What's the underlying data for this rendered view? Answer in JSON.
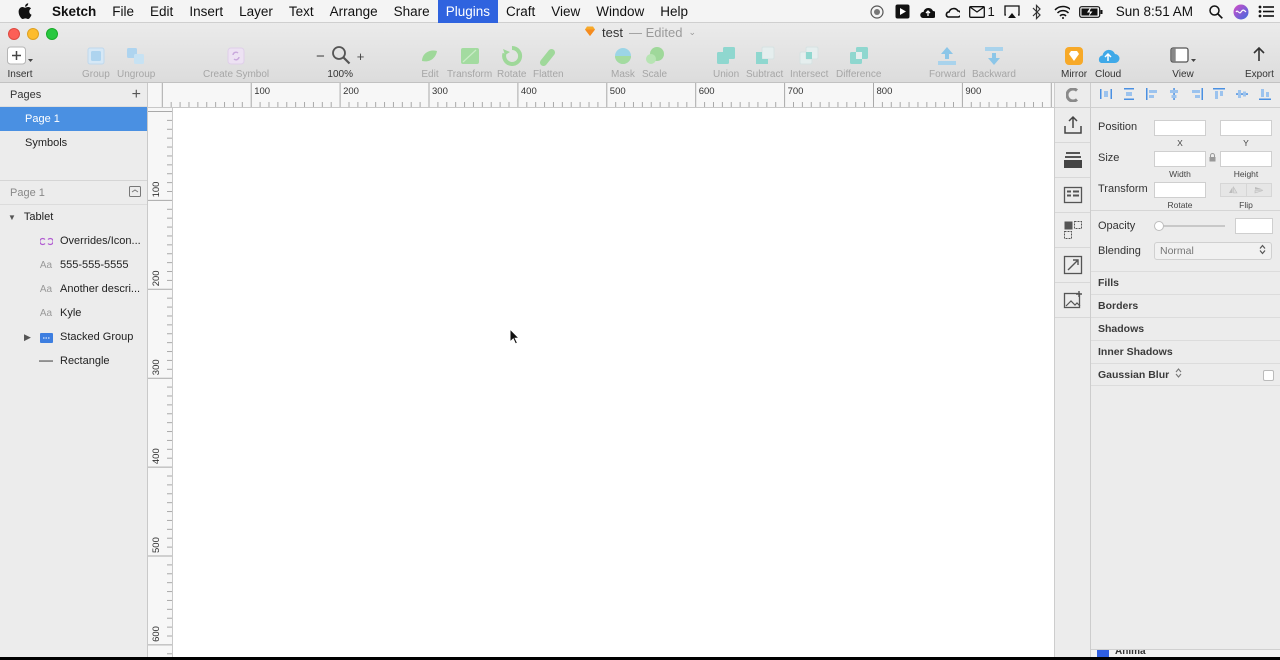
{
  "menubar": {
    "app_name": "Sketch",
    "items": [
      "File",
      "Edit",
      "Insert",
      "Layer",
      "Text",
      "Arrange",
      "Share",
      "Plugins",
      "Craft",
      "View",
      "Window",
      "Help"
    ],
    "active_item": "Plugins",
    "mail_count": "1",
    "clock": "Sun 8:51 AM"
  },
  "window": {
    "title": "test",
    "status": "— Edited"
  },
  "toolbar": {
    "insert": "Insert",
    "group": "Group",
    "ungroup": "Ungroup",
    "create_symbol": "Create Symbol",
    "zoom": "100%",
    "edit": "Edit",
    "transform": "Transform",
    "rotate": "Rotate",
    "flatten": "Flatten",
    "mask": "Mask",
    "scale": "Scale",
    "union": "Union",
    "subtract": "Subtract",
    "intersect": "Intersect",
    "difference": "Difference",
    "forward": "Forward",
    "backward": "Backward",
    "mirror": "Mirror",
    "cloud": "Cloud",
    "view": "View",
    "export": "Export"
  },
  "pages": {
    "header": "Pages",
    "items": [
      "Page 1",
      "Symbols"
    ],
    "selected": "Page 1"
  },
  "layers": {
    "header": "Page 1",
    "artboard": "Tablet",
    "items": [
      {
        "name": "Overrides/Icon...",
        "icon": "symbol-instance-icon"
      },
      {
        "name": "555-555-5555",
        "icon": "text-layer-icon"
      },
      {
        "name": "Another descri...",
        "icon": "text-layer-icon"
      },
      {
        "name": "Kyle",
        "icon": "text-layer-icon"
      },
      {
        "name": "Stacked Group",
        "icon": "folder-icon"
      },
      {
        "name": "Rectangle",
        "icon": "line-icon"
      }
    ],
    "text_icon_glyph": "Aa"
  },
  "rulers": {
    "top_labels": [
      "100",
      "200",
      "300",
      "400",
      "500",
      "600",
      "700",
      "800",
      "900"
    ],
    "left_labels": [
      "100",
      "200",
      "300",
      "400",
      "500",
      "600"
    ]
  },
  "inspector": {
    "position_label": "Position",
    "x_label": "X",
    "y_label": "Y",
    "size_label": "Size",
    "width_label": "Width",
    "height_label": "Height",
    "transform_label": "Transform",
    "rotate_label": "Rotate",
    "flip_label": "Flip",
    "opacity_label": "Opacity",
    "opacity_value": "",
    "blending_label": "Blending",
    "blending_value": "Normal",
    "sections": [
      "Fills",
      "Borders",
      "Shadows",
      "Inner Shadows",
      "Gaussian Blur"
    ],
    "bottom_panel": "Anima"
  },
  "colors": {
    "accent": "#2f63df",
    "selection": "#4a90e2",
    "toolbar_green": "#8fd18a",
    "toolbar_blue": "#7cc6e8",
    "toolbar_teal": "#6fd1c9",
    "sketch_orange": "#f7a928"
  }
}
